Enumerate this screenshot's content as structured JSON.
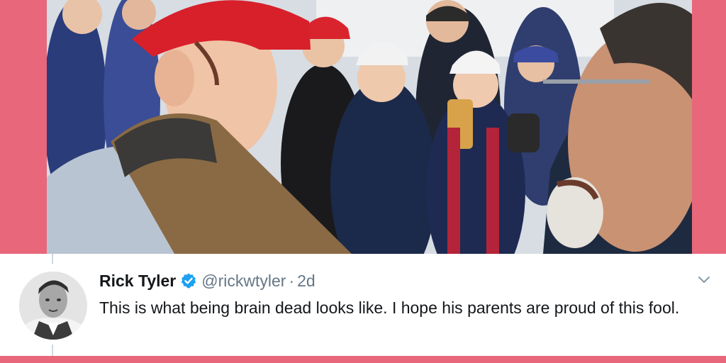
{
  "tweet": {
    "display_name": "Rick Tyler",
    "handle": "@rickwtyler",
    "separator": "·",
    "timestamp": "2d",
    "text": "This is what being brain dead looks like. I hope his parents are proud of this fool.",
    "verified": true
  },
  "colors": {
    "frame_background": "#e8677a",
    "card_background": "#ffffff",
    "verified_blue": "#1da1f2",
    "secondary_text": "#657786",
    "primary_text": "#14171a"
  },
  "icons": {
    "verified": "verified-badge-icon",
    "menu": "chevron-down-icon"
  }
}
